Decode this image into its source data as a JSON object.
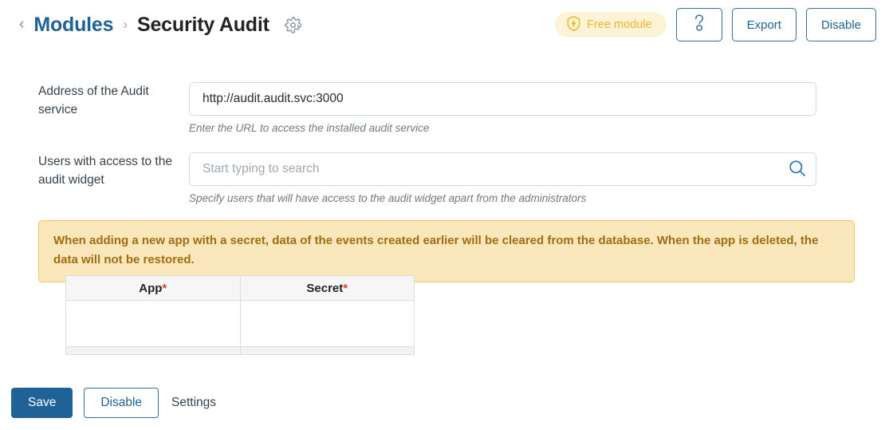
{
  "header": {
    "back_label": "‹",
    "breadcrumb_parent": "Modules",
    "breadcrumb_separator": "›",
    "page_title": "Security Audit",
    "settings_gear_icon": "gear-icon",
    "badge": {
      "icon": "shield-bolt-icon",
      "label": "Free module",
      "color": "#f0b429",
      "background": "#fdf3d7"
    },
    "actions": {
      "help_icon": "help-question-icon",
      "export_label": "Export",
      "disable_label": "Disable"
    },
    "accent_color": "#1f6296"
  },
  "form": {
    "fields": [
      {
        "label": "Address of the Audit service",
        "value": "http://audit.audit.svc:3000",
        "placeholder": "",
        "hint": "Enter the URL to access the installed audit service"
      },
      {
        "label": "Users with access to the audit widget",
        "value": "",
        "placeholder": "Start typing to search",
        "hint": "Specify users that will have access to the audit widget apart from the administrators",
        "icon": "search-icon"
      }
    ]
  },
  "warning": {
    "text": "When adding a new app with a secret, data of the events created earlier will be cleared from the database. When the app is deleted, the data will not be restored.",
    "background": "#fbe7bc",
    "border_color": "#f2c75c",
    "text_color": "#a06e12"
  },
  "apps_table": {
    "columns": [
      {
        "label": "App",
        "required_marker": "*"
      },
      {
        "label": "Secret",
        "required_marker": "*"
      }
    ],
    "rows": [
      {
        "app": "",
        "secret": ""
      }
    ],
    "required_color": "#e03a2f"
  },
  "footer": {
    "save_label": "Save",
    "disable_label": "Disable",
    "settings_label": "Settings",
    "primary_color": "#1f6298"
  }
}
